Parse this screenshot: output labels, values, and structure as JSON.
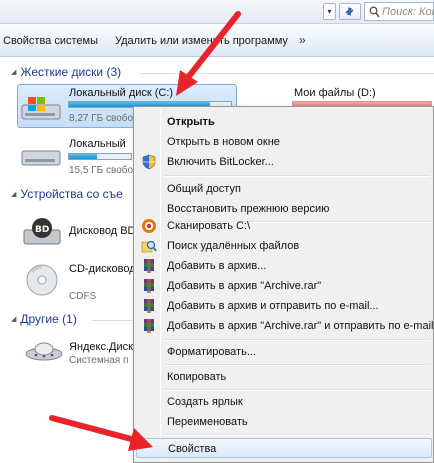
{
  "search": {
    "placeholder": "Поиск: Комп"
  },
  "toolbar": {
    "items": [
      {
        "label": "Свойства системы"
      },
      {
        "label": "Удалить или изменить программу"
      }
    ],
    "more": "»"
  },
  "groups": {
    "hard_drives": "Жесткие диски (3)",
    "removable": "Устройства со съе",
    "other": "Другие (1)"
  },
  "drives": [
    {
      "name": "Локальный диск (C:)",
      "free": "8,27 ГБ свобо",
      "used_fraction": 0.87
    },
    {
      "name": "Локальный",
      "free": "15,5 ГБ свобо",
      "used_fraction": 0.45
    },
    {
      "name": "Мои файлы (D:)",
      "used_fraction": 0.7
    },
    {
      "name": "Дисковод BD",
      "sub": ""
    },
    {
      "name": "CD-дисковод",
      "sub": "CDFS",
      "sub2": ""
    },
    {
      "name": "Яндекс.Диск",
      "sub": "Системная п"
    }
  ],
  "context_menu": {
    "items": [
      {
        "label": "Открыть",
        "icon": "none"
      },
      {
        "label": "Открыть в новом окне",
        "icon": "none"
      },
      {
        "label": "Включить BitLocker...",
        "icon": "shield-icon"
      },
      {
        "label": "Общий доступ",
        "icon": "none"
      },
      {
        "label": "Восстановить прежнюю версию",
        "icon": "none"
      },
      {
        "label": "Сканировать C:\\",
        "icon": "antivirus-icon"
      },
      {
        "label": "Поиск удалённых файлов",
        "icon": "search-files-icon"
      },
      {
        "label": "Добавить в архив...",
        "icon": "winrar-icon"
      },
      {
        "label": "Добавить в архив \"Archive.rar\"",
        "icon": "winrar-icon"
      },
      {
        "label": "Добавить в архив и отправить по e-mail...",
        "icon": "winrar-icon"
      },
      {
        "label": "Добавить в архив \"Archive.rar\" и отправить по e-mail",
        "icon": "winrar-icon"
      },
      {
        "label": "Форматировать...",
        "icon": "none"
      },
      {
        "label": "Копировать",
        "icon": "none"
      },
      {
        "label": "Создать ярлык",
        "icon": "none"
      },
      {
        "label": "Переименовать",
        "icon": "none"
      },
      {
        "label": "Свойства",
        "icon": "none"
      }
    ]
  },
  "colors": {
    "arrow": "#e8232a",
    "group_header": "#1e3a8a",
    "bar_fill": "#1e8fd0"
  }
}
